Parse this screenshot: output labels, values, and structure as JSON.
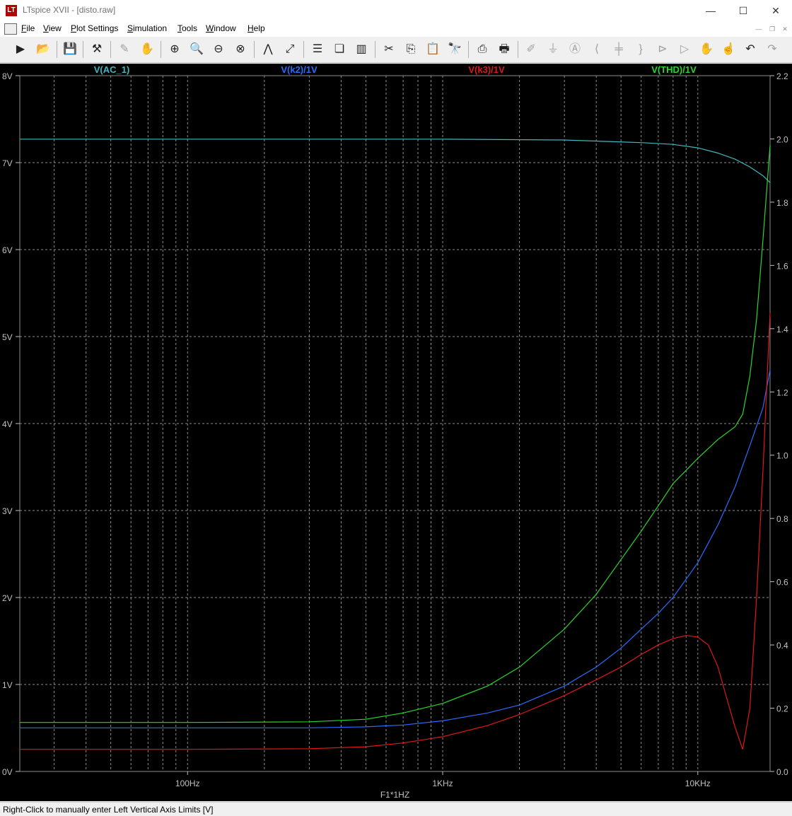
{
  "window": {
    "title": "LTspice XVII - [disto.raw]",
    "app_icon": "ltspice-icon",
    "minimize": "—",
    "maximize": "☐",
    "close": "✕"
  },
  "menu": [
    "File",
    "View",
    "Plot Settings",
    "Simulation",
    "Tools",
    "Window",
    "Help"
  ],
  "toolbar": [
    "run",
    "open",
    "save",
    "control-panel",
    "probe",
    "pan",
    "zoom-in",
    "zoom-rect",
    "zoom-out",
    "zoom-cancel",
    "autorange",
    "fit",
    "tile-horizontal",
    "cascade",
    "tile-vertical",
    "cut",
    "copy",
    "paste",
    "find",
    "print-preview",
    "print",
    "draw-wire",
    "ground",
    "label",
    "resistor",
    "capacitor",
    "inductor",
    "diode",
    "component",
    "move",
    "drag",
    "undo",
    "redo"
  ],
  "status": {
    "text": "Right-Click to manually enter Left Vertical Axis Limits [V]"
  },
  "colors": {
    "background": "#000000",
    "grid": "#8c8c8c",
    "axis_text": "#c0c0c0",
    "ac1": "#3fb8c0",
    "k2": "#2a6cff",
    "k3": "#e01818",
    "thd": "#2ad62a"
  },
  "chart_data": {
    "type": "line",
    "x_scale": "log",
    "xlim": [
      22,
      19200
    ],
    "xlabel": "F1*1HZ",
    "x_ticks": [
      {
        "v": 100,
        "label": "100Hz"
      },
      {
        "v": 1000,
        "label": "1KHz"
      },
      {
        "v": 10000,
        "label": "10KHz"
      }
    ],
    "y_left": {
      "range": [
        0,
        8
      ],
      "ticks": [
        {
          "v": 0,
          "label": "0V"
        },
        {
          "v": 1,
          "label": "1V"
        },
        {
          "v": 2,
          "label": "2V"
        },
        {
          "v": 3,
          "label": "3V"
        },
        {
          "v": 4,
          "label": "4V"
        },
        {
          "v": 5,
          "label": "5V"
        },
        {
          "v": 6,
          "label": "6V"
        },
        {
          "v": 7,
          "label": "7V"
        },
        {
          "v": 8,
          "label": "8V"
        }
      ]
    },
    "y_right": {
      "range": [
        0,
        2.2
      ],
      "ticks": [
        {
          "v": 0,
          "label": "0.0"
        },
        {
          "v": 0.2,
          "label": "0.2"
        },
        {
          "v": 0.4,
          "label": "0.4"
        },
        {
          "v": 0.6,
          "label": "0.6"
        },
        {
          "v": 0.8,
          "label": "0.8"
        },
        {
          "v": 1.0,
          "label": "1.0"
        },
        {
          "v": 1.2,
          "label": "1.2"
        },
        {
          "v": 1.4,
          "label": "1.4"
        },
        {
          "v": 1.6,
          "label": "1.6"
        },
        {
          "v": 1.8,
          "label": "1.8"
        },
        {
          "v": 2.0,
          "label": "2.0"
        },
        {
          "v": 2.2,
          "label": "2.2"
        }
      ]
    },
    "grid": true,
    "series": [
      {
        "name": "V(AC_1)",
        "axis": "left",
        "color": "#3fb8c0",
        "x": [
          22,
          100,
          1000,
          3000,
          6000,
          8000,
          10000,
          12000,
          14000,
          16000,
          18000,
          19200
        ],
        "y": [
          7.27,
          7.27,
          7.27,
          7.26,
          7.23,
          7.21,
          7.17,
          7.11,
          7.04,
          6.95,
          6.85,
          6.77
        ]
      },
      {
        "name": "V(k2)/1V",
        "axis": "right",
        "color": "#2a6cff",
        "x": [
          22,
          100,
          300,
          500,
          700,
          1000,
          1500,
          2000,
          3000,
          4000,
          5000,
          6000,
          7000,
          8000,
          10000,
          12000,
          14000,
          16000,
          18000,
          19200
        ],
        "y": [
          0.138,
          0.138,
          0.138,
          0.141,
          0.147,
          0.16,
          0.185,
          0.21,
          0.27,
          0.33,
          0.39,
          0.45,
          0.5,
          0.55,
          0.66,
          0.78,
          0.9,
          1.03,
          1.15,
          1.27
        ]
      },
      {
        "name": "V(k3)/1V",
        "axis": "right",
        "color": "#e01818",
        "x": [
          22,
          100,
          300,
          500,
          700,
          1000,
          1500,
          2000,
          3000,
          4000,
          5000,
          6000,
          7000,
          8000,
          9000,
          10000,
          11000,
          12000,
          13000,
          14000,
          15000,
          16000,
          17000,
          18000,
          19200
        ],
        "y": [
          0.07,
          0.07,
          0.072,
          0.078,
          0.09,
          0.11,
          0.145,
          0.18,
          0.24,
          0.29,
          0.33,
          0.37,
          0.4,
          0.42,
          0.43,
          0.425,
          0.4,
          0.33,
          0.23,
          0.14,
          0.07,
          0.2,
          0.55,
          0.95,
          1.45
        ]
      },
      {
        "name": "V(THD)/1V",
        "axis": "right",
        "color": "#2ad62a",
        "x": [
          22,
          100,
          300,
          500,
          700,
          1000,
          1500,
          2000,
          3000,
          4000,
          5000,
          6000,
          7000,
          8000,
          10000,
          12000,
          14000,
          15000,
          16000,
          17000,
          18000,
          19200
        ],
        "y": [
          0.155,
          0.155,
          0.157,
          0.165,
          0.185,
          0.215,
          0.27,
          0.33,
          0.45,
          0.56,
          0.67,
          0.76,
          0.84,
          0.91,
          0.99,
          1.05,
          1.09,
          1.13,
          1.25,
          1.43,
          1.68,
          1.98
        ]
      }
    ]
  }
}
